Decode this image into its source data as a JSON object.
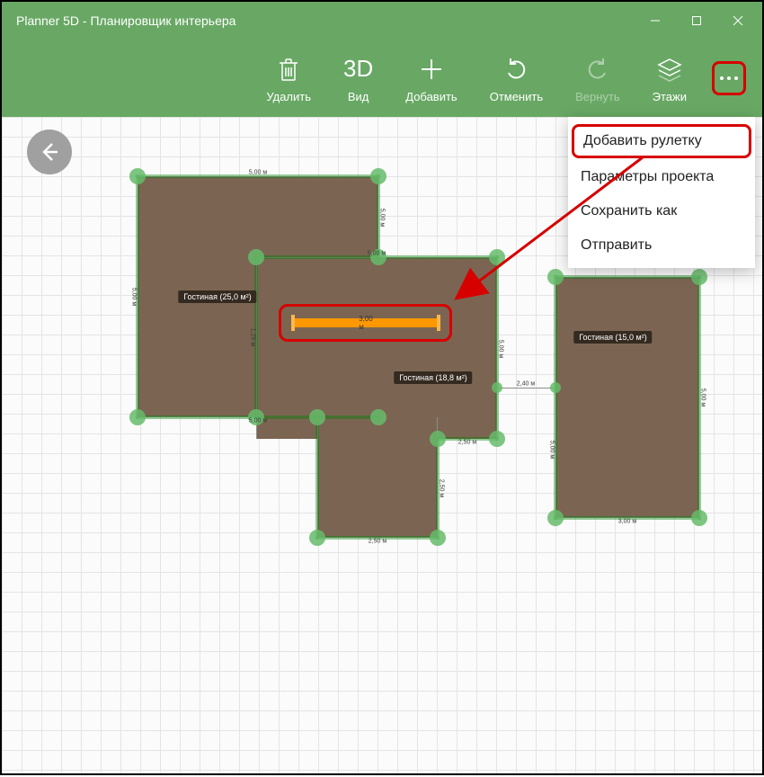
{
  "window": {
    "title": "Planner 5D - Планировщик интерьера"
  },
  "toolbar": {
    "delete": "Удалить",
    "view": "Вид",
    "view_icon_text": "3D",
    "add": "Добавить",
    "undo": "Отменить",
    "redo": "Вернуть",
    "floors": "Этажи"
  },
  "menu": {
    "add_ruler": "Добавить рулетку",
    "project_settings": "Параметры проекта",
    "save_as": "Сохранить как",
    "send": "Отправить"
  },
  "rooms": {
    "r1": {
      "label": "Гостиная (25,0 м²)",
      "top": "5,00 м",
      "bottom": "5,00 м",
      "left": "5,00 м",
      "right": "5,00 м"
    },
    "r2": {
      "label": "Гостиная (18,8 м²)",
      "top": "5,00 м",
      "bottom": "2,50 м",
      "left_upper": "1,25 м",
      "left_lower": "2,50 м",
      "right": "5,00 м",
      "bottom_right": "2,50 м"
    },
    "r3": {
      "label": "Гостиная (15,0 м²)",
      "top": "2,40 м",
      "bottom": "3,00 м",
      "left": "5,00 м",
      "right": "5,00 м"
    }
  },
  "ruler": {
    "value": "3,00 м"
  }
}
